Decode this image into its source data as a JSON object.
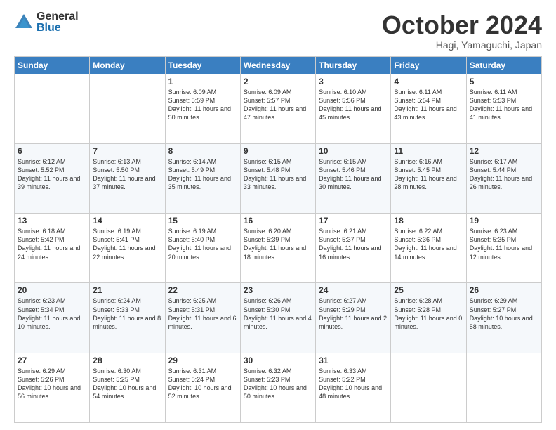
{
  "header": {
    "logo_general": "General",
    "logo_blue": "Blue",
    "month_title": "October 2024",
    "subtitle": "Hagi, Yamaguchi, Japan"
  },
  "days_of_week": [
    "Sunday",
    "Monday",
    "Tuesday",
    "Wednesday",
    "Thursday",
    "Friday",
    "Saturday"
  ],
  "weeks": [
    [
      {
        "day": "",
        "content": ""
      },
      {
        "day": "",
        "content": ""
      },
      {
        "day": "1",
        "content": "Sunrise: 6:09 AM\nSunset: 5:59 PM\nDaylight: 11 hours and 50 minutes."
      },
      {
        "day": "2",
        "content": "Sunrise: 6:09 AM\nSunset: 5:57 PM\nDaylight: 11 hours and 47 minutes."
      },
      {
        "day": "3",
        "content": "Sunrise: 6:10 AM\nSunset: 5:56 PM\nDaylight: 11 hours and 45 minutes."
      },
      {
        "day": "4",
        "content": "Sunrise: 6:11 AM\nSunset: 5:54 PM\nDaylight: 11 hours and 43 minutes."
      },
      {
        "day": "5",
        "content": "Sunrise: 6:11 AM\nSunset: 5:53 PM\nDaylight: 11 hours and 41 minutes."
      }
    ],
    [
      {
        "day": "6",
        "content": "Sunrise: 6:12 AM\nSunset: 5:52 PM\nDaylight: 11 hours and 39 minutes."
      },
      {
        "day": "7",
        "content": "Sunrise: 6:13 AM\nSunset: 5:50 PM\nDaylight: 11 hours and 37 minutes."
      },
      {
        "day": "8",
        "content": "Sunrise: 6:14 AM\nSunset: 5:49 PM\nDaylight: 11 hours and 35 minutes."
      },
      {
        "day": "9",
        "content": "Sunrise: 6:15 AM\nSunset: 5:48 PM\nDaylight: 11 hours and 33 minutes."
      },
      {
        "day": "10",
        "content": "Sunrise: 6:15 AM\nSunset: 5:46 PM\nDaylight: 11 hours and 30 minutes."
      },
      {
        "day": "11",
        "content": "Sunrise: 6:16 AM\nSunset: 5:45 PM\nDaylight: 11 hours and 28 minutes."
      },
      {
        "day": "12",
        "content": "Sunrise: 6:17 AM\nSunset: 5:44 PM\nDaylight: 11 hours and 26 minutes."
      }
    ],
    [
      {
        "day": "13",
        "content": "Sunrise: 6:18 AM\nSunset: 5:42 PM\nDaylight: 11 hours and 24 minutes."
      },
      {
        "day": "14",
        "content": "Sunrise: 6:19 AM\nSunset: 5:41 PM\nDaylight: 11 hours and 22 minutes."
      },
      {
        "day": "15",
        "content": "Sunrise: 6:19 AM\nSunset: 5:40 PM\nDaylight: 11 hours and 20 minutes."
      },
      {
        "day": "16",
        "content": "Sunrise: 6:20 AM\nSunset: 5:39 PM\nDaylight: 11 hours and 18 minutes."
      },
      {
        "day": "17",
        "content": "Sunrise: 6:21 AM\nSunset: 5:37 PM\nDaylight: 11 hours and 16 minutes."
      },
      {
        "day": "18",
        "content": "Sunrise: 6:22 AM\nSunset: 5:36 PM\nDaylight: 11 hours and 14 minutes."
      },
      {
        "day": "19",
        "content": "Sunrise: 6:23 AM\nSunset: 5:35 PM\nDaylight: 11 hours and 12 minutes."
      }
    ],
    [
      {
        "day": "20",
        "content": "Sunrise: 6:23 AM\nSunset: 5:34 PM\nDaylight: 11 hours and 10 minutes."
      },
      {
        "day": "21",
        "content": "Sunrise: 6:24 AM\nSunset: 5:33 PM\nDaylight: 11 hours and 8 minutes."
      },
      {
        "day": "22",
        "content": "Sunrise: 6:25 AM\nSunset: 5:31 PM\nDaylight: 11 hours and 6 minutes."
      },
      {
        "day": "23",
        "content": "Sunrise: 6:26 AM\nSunset: 5:30 PM\nDaylight: 11 hours and 4 minutes."
      },
      {
        "day": "24",
        "content": "Sunrise: 6:27 AM\nSunset: 5:29 PM\nDaylight: 11 hours and 2 minutes."
      },
      {
        "day": "25",
        "content": "Sunrise: 6:28 AM\nSunset: 5:28 PM\nDaylight: 11 hours and 0 minutes."
      },
      {
        "day": "26",
        "content": "Sunrise: 6:29 AM\nSunset: 5:27 PM\nDaylight: 10 hours and 58 minutes."
      }
    ],
    [
      {
        "day": "27",
        "content": "Sunrise: 6:29 AM\nSunset: 5:26 PM\nDaylight: 10 hours and 56 minutes."
      },
      {
        "day": "28",
        "content": "Sunrise: 6:30 AM\nSunset: 5:25 PM\nDaylight: 10 hours and 54 minutes."
      },
      {
        "day": "29",
        "content": "Sunrise: 6:31 AM\nSunset: 5:24 PM\nDaylight: 10 hours and 52 minutes."
      },
      {
        "day": "30",
        "content": "Sunrise: 6:32 AM\nSunset: 5:23 PM\nDaylight: 10 hours and 50 minutes."
      },
      {
        "day": "31",
        "content": "Sunrise: 6:33 AM\nSunset: 5:22 PM\nDaylight: 10 hours and 48 minutes."
      },
      {
        "day": "",
        "content": ""
      },
      {
        "day": "",
        "content": ""
      }
    ]
  ]
}
